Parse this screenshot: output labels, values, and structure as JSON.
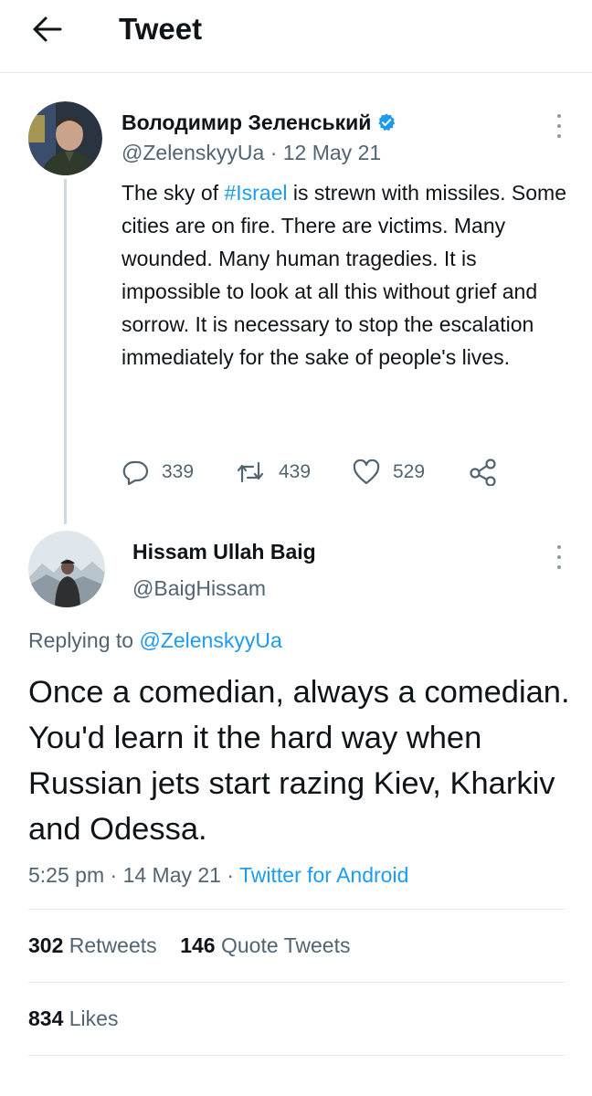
{
  "header": {
    "title": "Tweet",
    "back_icon": "arrow-left-icon"
  },
  "parent_tweet": {
    "display_name": "Володимир Зеленський",
    "verified": true,
    "handle": "@ZelenskyyUa",
    "date": "12 May 21",
    "text_before": "The sky of ",
    "hashtag": "#Israel",
    "text_after": " is strewn with missiles. Some cities are on fire. There are victims. Many wounded. Many human tragedies. It is impossible to look at all this without grief and sorrow. It is necessary to stop the escalation immediately for the sake of people's lives.",
    "replies": "339",
    "retweets": "439",
    "likes": "529"
  },
  "main_tweet": {
    "display_name": "Hissam Ullah Baig",
    "handle": "@BaigHissam",
    "replying_label": "Replying to",
    "replying_to": "@ZelenskyyUa",
    "text": "Once a comedian, always a comedian. You'd learn it the hard way when Russian jets start razing Kiev, Kharkiv and Odessa.",
    "time": "5:25 pm",
    "date": "14 May 21",
    "source": "Twitter for Android",
    "retweets_count": "302",
    "retweets_label": "Retweets",
    "quotes_count": "146",
    "quotes_label": "Quote Tweets",
    "likes_count": "834",
    "likes_label": "Likes"
  },
  "colors": {
    "accent": "#1d9bf0",
    "muted": "#536471",
    "text": "#0f1419",
    "divider": "#e6e9eb"
  }
}
